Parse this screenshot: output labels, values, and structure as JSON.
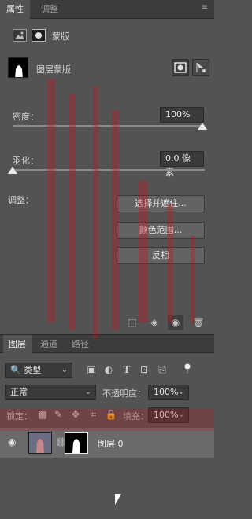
{
  "properties_panel": {
    "tabs": [
      {
        "label": "属性",
        "active": true
      },
      {
        "label": "调整",
        "active": false
      }
    ],
    "section_header": "蒙版",
    "mask_type_label": "图层蒙版",
    "density": {
      "label": "密度：",
      "value": "100%",
      "level": 1.0
    },
    "feather": {
      "label": "羽化：",
      "value": "0.0 像素",
      "level": 0.0
    },
    "refine": {
      "label": "调整：",
      "buttons": [
        "选择并遮住...",
        "颜色范围...",
        "反相"
      ]
    },
    "footer_icons": [
      "load-selection-icon",
      "apply-mask-icon",
      "visibility-icon",
      "delete-icon"
    ]
  },
  "layers_panel": {
    "tabs": [
      {
        "label": "图层",
        "active": true
      },
      {
        "label": "通道",
        "active": false
      },
      {
        "label": "路径",
        "active": false
      }
    ],
    "filter": {
      "label": "类型",
      "icons": [
        "image-filter-icon",
        "adjustment-filter-icon",
        "type-filter-icon",
        "shape-filter-icon",
        "smart-object-filter-icon",
        "toggle-filter-icon"
      ]
    },
    "blend_mode": "正常",
    "opacity": {
      "label": "不透明度：",
      "value": "100%"
    },
    "lock": {
      "label": "锁定：",
      "icons": [
        "lock-transparency-icon",
        "lock-pixels-icon",
        "lock-position-icon",
        "lock-artboard-icon",
        "lock-all-icon"
      ]
    },
    "fill": {
      "label": "填充：",
      "value": "100%"
    },
    "layers": [
      {
        "name": "图层 0",
        "visible": true
      }
    ]
  },
  "colors": {
    "panel_bg": "#535353",
    "tab_bar_bg": "#3c3c3c",
    "selected_layer_bg": "#6a6a6a",
    "overlay_red": "#c81423"
  }
}
